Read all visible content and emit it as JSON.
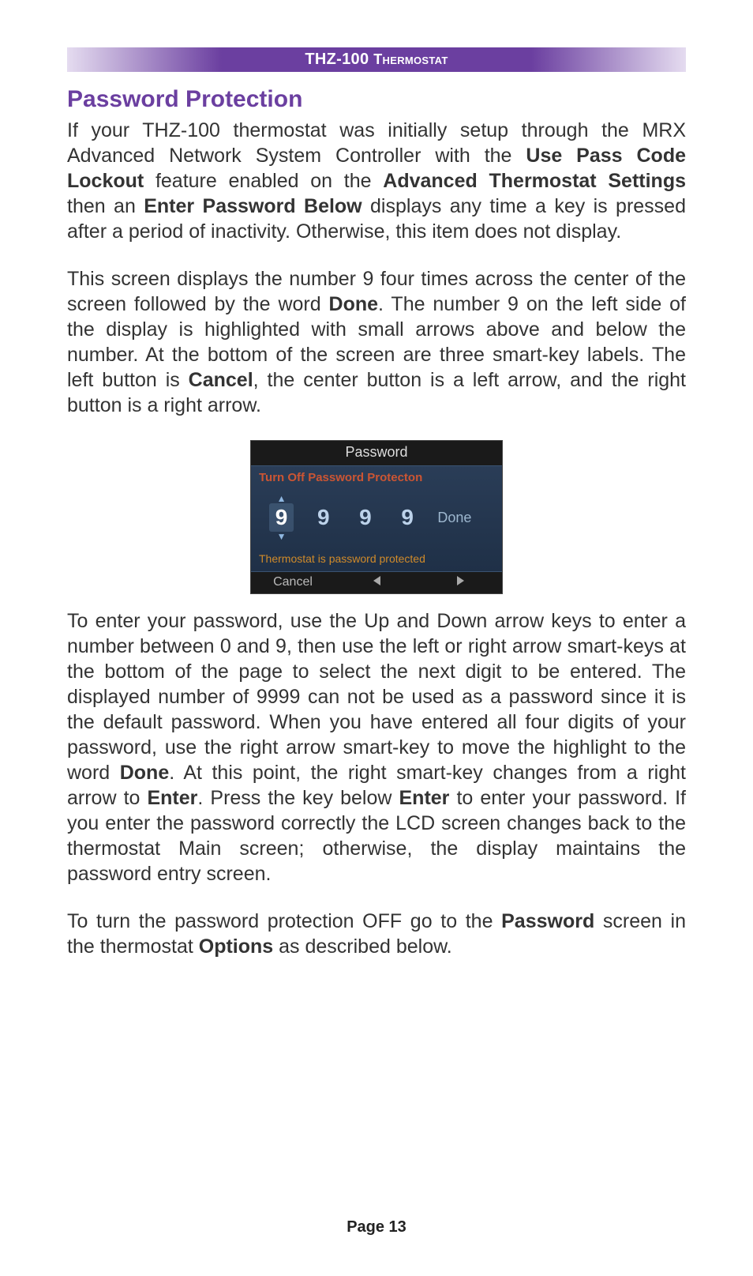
{
  "header": {
    "product": "THZ-100",
    "suffix": "Thermostat"
  },
  "section_title": "Password Protection",
  "para1": {
    "t1": "If your THZ-100 thermostat was initially setup through the MRX Advanced Network System Controller with the ",
    "b1": "Use Pass Code Lockout",
    "t2": " feature enabled on the ",
    "b2": "Advanced Thermostat Settings",
    "t3": " then an ",
    "b3": "Enter Password Below",
    "t4": " displays any time a key is pressed after a period of inactivity. Otherwise, this item does not display."
  },
  "para2": {
    "t1": "This screen displays the number 9 four times across the center of the screen followed by the word ",
    "b1": "Done",
    "t2": ". The number 9 on the left side of the display is highlighted with small arrows above and below the number. At the bottom of the screen are three smart-key labels. The left button is ",
    "b2": "Cancel",
    "t3": ", the center button is a left arrow, and the right button is a right arrow."
  },
  "device": {
    "title": "Password",
    "subtitle": "Turn Off Password Protecton",
    "digits": [
      "9",
      "9",
      "9",
      "9"
    ],
    "done": "Done",
    "status": "Thermostat is password protected",
    "footer_left": "Cancel"
  },
  "para3": {
    "t1": "To enter your password, use the Up and Down arrow keys to enter a number between 0 and 9, then use the left or right arrow smart-keys at the bottom of the page to select the next digit to be entered. The displayed number of 9999 can not be used as a password since it is the default password. When you have entered all four digits of your password, use the right arrow smart-key to move the highlight to the word ",
    "b1": "Done",
    "t2": ". At this point, the right smart-key changes from a right arrow to ",
    "b2": "Enter",
    "t3": ". Press the key below ",
    "b3": "Enter",
    "t4": " to enter your password. If you enter the password correctly the LCD screen changes back to the thermostat Main screen; otherwise, the display maintains the password entry screen."
  },
  "para4": {
    "t1": "To turn the password protection OFF go to the ",
    "b1": "Password",
    "t2": " screen in the thermostat ",
    "b2": "Options",
    "t3": " as described below."
  },
  "page_number": "Page 13"
}
